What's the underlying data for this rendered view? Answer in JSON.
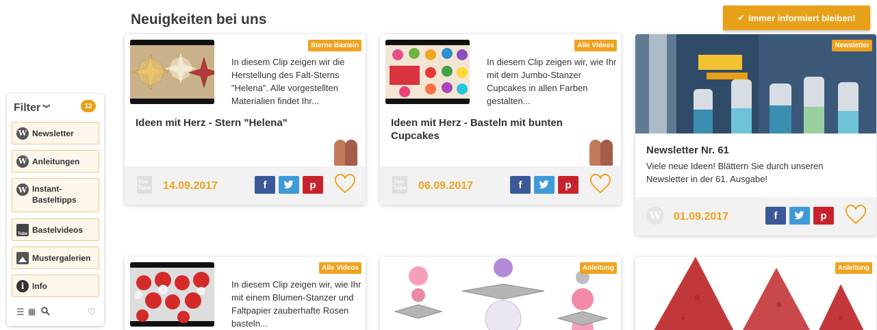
{
  "header": {
    "title": "Neuigkeiten bei uns",
    "subscribe_label": "Immer informiert bleiben!"
  },
  "filter": {
    "title": "Filter",
    "count": "12",
    "items": [
      {
        "label": "Newsletter",
        "icon": "wordpress-icon"
      },
      {
        "label": "Anleitungen",
        "icon": "wordpress-icon"
      },
      {
        "label": "Instant-\nBasteltipps",
        "icon": "wordpress-icon"
      },
      {
        "label": "Bastelvideos",
        "icon": "youtube-icon"
      },
      {
        "label": "Mustergalerien",
        "icon": "image-icon"
      },
      {
        "label": "Info",
        "icon": "info-icon"
      }
    ],
    "tools": [
      "list-view-icon",
      "grid-view-icon",
      "search-icon",
      "heart-icon"
    ]
  },
  "cards": [
    {
      "tag": "Sterne Basteln",
      "excerpt": "In diesem Clip zeigen wir die Herstellung des Falt-Sterns \"Helena\". Alle vorgestellten Materialien findet Ihr...",
      "title": "Ideen mit Herz - Stern \"Helena\"",
      "date": "14.09.2017",
      "source": "youtube"
    },
    {
      "tag": "Alle Videos",
      "excerpt": "In diesem Clip zeigen wir, wie Ihr mit dem Jumbo-Stanzer Cupcakes in allen Farben gestalten...",
      "title": "Ideen mit Herz - Basteln mit bunten Cupcakes",
      "date": "06.09.2017",
      "source": "youtube"
    },
    {
      "tag": "Newsletter",
      "title": "Newsletter Nr. 61",
      "excerpt": "Viele neue Ideen! Blättern Sie durch unseren Newsletter in der 61. Ausgabe!",
      "date": "01.09.2017",
      "source": "wordpress"
    },
    {
      "tag": "Alle Videos",
      "excerpt": "In diesem Clip zeigen wir, wie Ihr mit einem Blumen-Stanzer und Faltpapier zauberhafte Rosen basteln..."
    },
    {
      "tag": "Anleitung"
    },
    {
      "tag": "Anleitung"
    }
  ],
  "share": {
    "facebook": "f",
    "twitter": "t",
    "pinterest": "p"
  },
  "colors": {
    "accent": "#f0a21e",
    "facebook": "#3b5998",
    "twitter": "#3f9ad8",
    "pinterest": "#c8232c"
  }
}
